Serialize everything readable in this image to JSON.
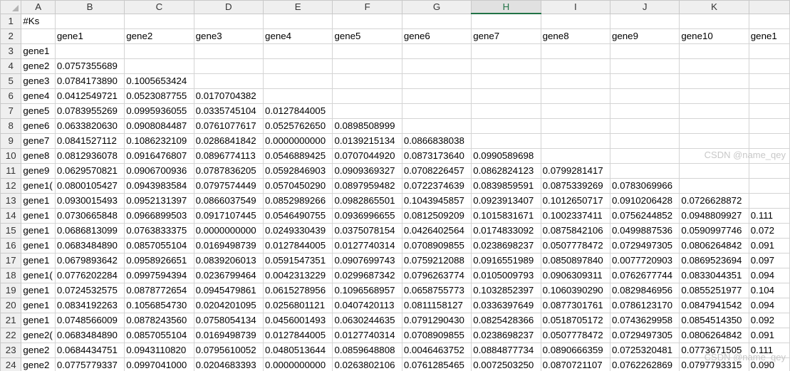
{
  "columns": [
    "A",
    "B",
    "C",
    "D",
    "E",
    "F",
    "G",
    "H",
    "I",
    "J",
    "K",
    ""
  ],
  "selected_column": "H",
  "rows": [
    {
      "n": "1",
      "cells": [
        "#Ks",
        "",
        "",
        "",
        "",
        "",
        "",
        "",
        "",
        "",
        "",
        ""
      ]
    },
    {
      "n": "2",
      "cells": [
        "",
        "gene1",
        "gene2",
        "gene3",
        "gene4",
        "gene5",
        "gene6",
        "gene7",
        "gene8",
        "gene9",
        "gene10",
        "gene1"
      ]
    },
    {
      "n": "3",
      "cells": [
        "gene1",
        "",
        "",
        "",
        "",
        "",
        "",
        "",
        "",
        "",
        "",
        ""
      ]
    },
    {
      "n": "4",
      "cells": [
        "gene2",
        "0.0757355689",
        "",
        "",
        "",
        "",
        "",
        "",
        "",
        "",
        "",
        ""
      ]
    },
    {
      "n": "5",
      "cells": [
        "gene3",
        "0.0784173890",
        "0.1005653424",
        "",
        "",
        "",
        "",
        "",
        "",
        "",
        "",
        ""
      ]
    },
    {
      "n": "6",
      "cells": [
        "gene4",
        "0.0412549721",
        "0.0523087755",
        "0.0170704382",
        "",
        "",
        "",
        "",
        "",
        "",
        "",
        ""
      ]
    },
    {
      "n": "7",
      "cells": [
        "gene5",
        "0.0783955269",
        "0.0995936055",
        "0.0335745104",
        "0.0127844005",
        "",
        "",
        "",
        "",
        "",
        "",
        ""
      ]
    },
    {
      "n": "8",
      "cells": [
        "gene6",
        "0.0633820630",
        "0.0908084487",
        "0.0761077617",
        "0.0525762650",
        "0.0898508999",
        "",
        "",
        "",
        "",
        "",
        ""
      ]
    },
    {
      "n": "9",
      "cells": [
        "gene7",
        "0.0841527112",
        "0.1086232109",
        "0.0286841842",
        "0.0000000000",
        "0.0139215134",
        "0.0866838038",
        "",
        "",
        "",
        "",
        ""
      ]
    },
    {
      "n": "10",
      "cells": [
        "gene8",
        "0.0812936078",
        "0.0916476807",
        "0.0896774113",
        "0.0546889425",
        "0.0707044920",
        "0.0873173640",
        "0.0990589698",
        "",
        "",
        "",
        ""
      ]
    },
    {
      "n": "11",
      "cells": [
        "gene9",
        "0.0629570821",
        "0.0906700936",
        "0.0787836205",
        "0.0592846903",
        "0.0909369327",
        "0.0708226457",
        "0.0862824123",
        "0.0799281417",
        "",
        "",
        ""
      ]
    },
    {
      "n": "12",
      "cells": [
        "gene1(",
        "0.0800105427",
        "0.0943983584",
        "0.0797574449",
        "0.0570450290",
        "0.0897959482",
        "0.0722374639",
        "0.0839859591",
        "0.0875339269",
        "0.0783069966",
        "",
        ""
      ]
    },
    {
      "n": "13",
      "cells": [
        "gene1",
        "0.0930015493",
        "0.0952131397",
        "0.0866037549",
        "0.0852989266",
        "0.0982865501",
        "0.1043945857",
        "0.0923913407",
        "0.1012650717",
        "0.0910206428",
        "0.0726628872",
        ""
      ]
    },
    {
      "n": "14",
      "cells": [
        "gene1",
        "0.0730665848",
        "0.0966899503",
        "0.0917107445",
        "0.0546490755",
        "0.0936996655",
        "0.0812509209",
        "0.1015831671",
        "0.1002337411",
        "0.0756244852",
        "0.0948809927",
        "0.111"
      ]
    },
    {
      "n": "15",
      "cells": [
        "gene1",
        "0.0686813099",
        "0.0763833375",
        "0.0000000000",
        "0.0249330439",
        "0.0375078154",
        "0.0426402564",
        "0.0174833092",
        "0.0875842106",
        "0.0499887536",
        "0.0590997746",
        "0.072"
      ]
    },
    {
      "n": "16",
      "cells": [
        "gene1",
        "0.0683484890",
        "0.0857055104",
        "0.0169498739",
        "0.0127844005",
        "0.0127740314",
        "0.0708909855",
        "0.0238698237",
        "0.0507778472",
        "0.0729497305",
        "0.0806264842",
        "0.091"
      ]
    },
    {
      "n": "17",
      "cells": [
        "gene1",
        "0.0679893642",
        "0.0958926651",
        "0.0839206013",
        "0.0591547351",
        "0.0907699743",
        "0.0759212088",
        "0.0916551989",
        "0.0850897840",
        "0.0077720903",
        "0.0869523694",
        "0.097"
      ]
    },
    {
      "n": "18",
      "cells": [
        "gene1(",
        "0.0776202284",
        "0.0997594394",
        "0.0236799464",
        "0.0042313229",
        "0.0299687342",
        "0.0796263774",
        "0.0105009793",
        "0.0906309311",
        "0.0762677744",
        "0.0833044351",
        "0.094"
      ]
    },
    {
      "n": "19",
      "cells": [
        "gene1",
        "0.0724532575",
        "0.0878772654",
        "0.0945479861",
        "0.0615278956",
        "0.1096568957",
        "0.0658755773",
        "0.1032852397",
        "0.1060390290",
        "0.0829846956",
        "0.0855251977",
        "0.104"
      ]
    },
    {
      "n": "20",
      "cells": [
        "gene1",
        "0.0834192263",
        "0.1056854730",
        "0.0204201095",
        "0.0256801121",
        "0.0407420113",
        "0.0811158127",
        "0.0336397649",
        "0.0877301761",
        "0.0786123170",
        "0.0847941542",
        "0.094"
      ]
    },
    {
      "n": "21",
      "cells": [
        "gene1",
        "0.0748566009",
        "0.0878243560",
        "0.0758054134",
        "0.0456001493",
        "0.0630244635",
        "0.0791290430",
        "0.0825428366",
        "0.0518705172",
        "0.0743629958",
        "0.0854514350",
        "0.092"
      ]
    },
    {
      "n": "22",
      "cells": [
        "gene2(",
        "0.0683484890",
        "0.0857055104",
        "0.0169498739",
        "0.0127844005",
        "0.0127740314",
        "0.0708909855",
        "0.0238698237",
        "0.0507778472",
        "0.0729497305",
        "0.0806264842",
        "0.091"
      ]
    },
    {
      "n": "23",
      "cells": [
        "gene2",
        "0.0684434751",
        "0.0943110820",
        "0.0795610052",
        "0.0480513644",
        "0.0859648808",
        "0.0046463752",
        "0.0884877734",
        "0.0890666359",
        "0.0725320481",
        "0.0773671505",
        "0.111"
      ]
    },
    {
      "n": "24",
      "cells": [
        "gene2",
        "0.0775779337",
        "0.0997041000",
        "0.0204683393",
        "0.0000000000",
        "0.0263802106",
        "0.0761285465",
        "0.0072503250",
        "0.0870721107",
        "0.0762262869",
        "0.0797793315",
        "0.090"
      ]
    }
  ],
  "watermark": "CSDN @name_qey"
}
